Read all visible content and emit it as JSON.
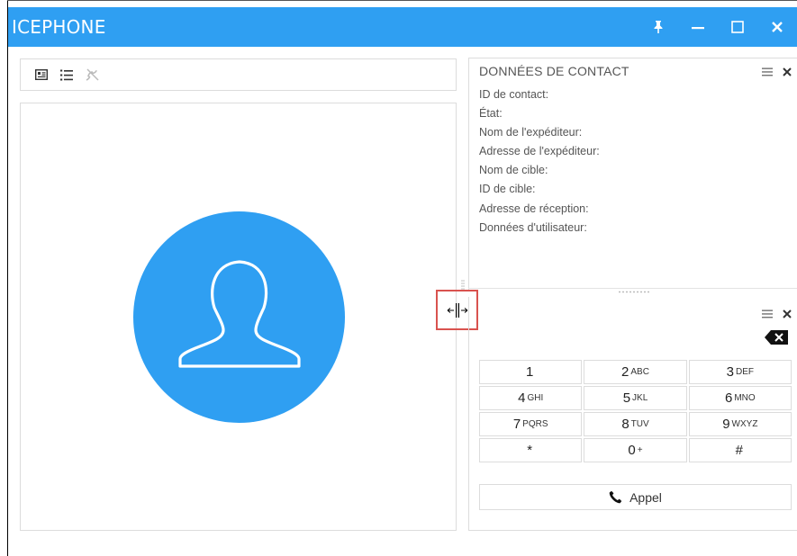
{
  "app": {
    "title": "ICEPHONE"
  },
  "colors": {
    "accent": "#2f9ff2",
    "highlight": "#d9534f"
  },
  "window_controls": [
    "pin-icon",
    "minimize-icon",
    "maximize-icon",
    "close-icon"
  ],
  "toolbar": {
    "icons": [
      "contact-card-icon",
      "call-list-icon",
      "missed-call-icon"
    ]
  },
  "contact_panel": {
    "title": "DONNÉES DE CONTACT",
    "fields": [
      "ID de contact:",
      "État:",
      "Nom de l'expéditeur:",
      "Adresse de l'expéditeur:",
      "Nom de cible:",
      "ID de cible:",
      "Adresse de réception:",
      "Données d'utilisateur:"
    ]
  },
  "dialer": {
    "keys": [
      {
        "digit": "1",
        "letters": ""
      },
      {
        "digit": "2",
        "letters": "ABC"
      },
      {
        "digit": "3",
        "letters": "DEF"
      },
      {
        "digit": "4",
        "letters": "GHI"
      },
      {
        "digit": "5",
        "letters": "JKL"
      },
      {
        "digit": "6",
        "letters": "MNO"
      },
      {
        "digit": "7",
        "letters": "PQRS"
      },
      {
        "digit": "8",
        "letters": "TUV"
      },
      {
        "digit": "9",
        "letters": "WXYZ"
      },
      {
        "digit": "*",
        "letters": ""
      },
      {
        "digit": "0",
        "letters": "+"
      },
      {
        "digit": "#",
        "letters": ""
      }
    ],
    "call_label": "Appel"
  }
}
